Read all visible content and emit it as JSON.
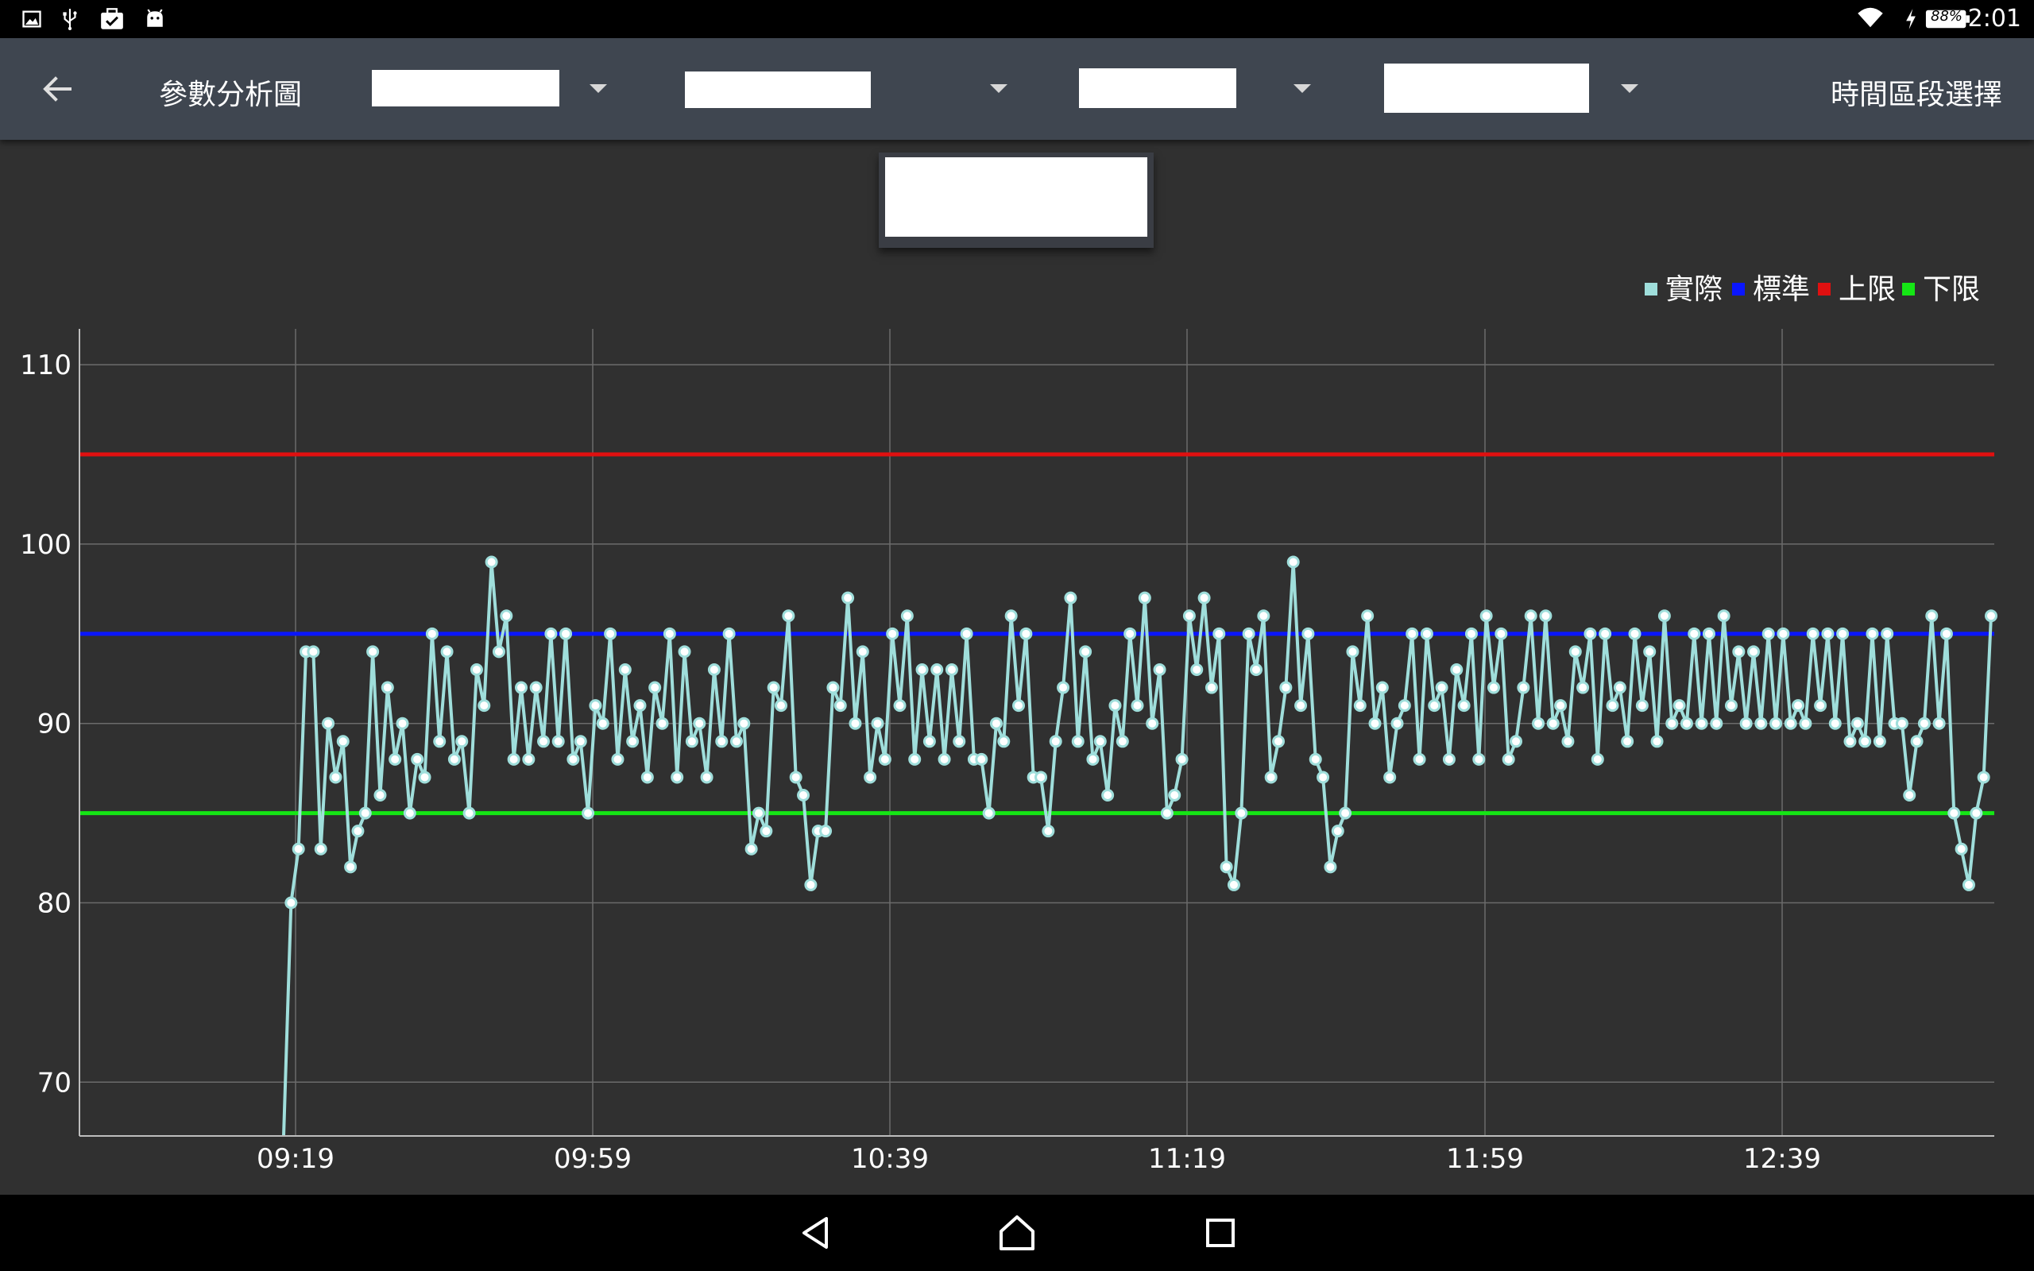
{
  "status_bar": {
    "time": "2:01",
    "battery": "88%",
    "left_icons": [
      "image-notification-icon",
      "usb-icon",
      "task-icon",
      "android-icon"
    ],
    "right_icons": [
      "wifi-icon",
      "charging-icon",
      "battery-icon"
    ]
  },
  "toolbar": {
    "title": "參數分析圖",
    "time_range_label": "時間區段選擇",
    "dropdowns": [
      {
        "value": ""
      },
      {
        "value": ""
      },
      {
        "value": ""
      },
      {
        "value": ""
      }
    ]
  },
  "center_card": {
    "value": ""
  },
  "colors": {
    "background": "#303030",
    "toolbar": "#3f4650",
    "actual": "#9fdedb",
    "standard": "#0a16ff",
    "upper_limit": "#e01010",
    "lower_limit": "#15e615",
    "grid": "#6b6b6b"
  },
  "chart_data": {
    "type": "line",
    "legend_position": "top-right",
    "grid": true,
    "ylim": [
      67,
      112
    ],
    "y_ticks": [
      70,
      80,
      90,
      100,
      110
    ],
    "x_tick_labels": [
      "09:19",
      "09:59",
      "10:39",
      "11:19",
      "11:59",
      "12:39"
    ],
    "x_range_minutes": [
      559,
      817
    ],
    "x_ticks_minutes": [
      559,
      599,
      639,
      679,
      719,
      759
    ],
    "actual_start_minute": 557,
    "series": [
      {
        "name": "實際",
        "color": "#9fdedb"
      },
      {
        "name": "標準",
        "color": "#0a16ff",
        "value": 95
      },
      {
        "name": "上限",
        "color": "#e01010",
        "value": 105
      },
      {
        "name": "下限",
        "color": "#15e615",
        "value": 85
      }
    ],
    "actual_values": [
      67,
      80,
      83,
      94,
      94,
      83,
      90,
      87,
      89,
      82,
      84,
      85,
      94,
      86,
      92,
      88,
      90,
      85,
      88,
      87,
      95,
      89,
      94,
      88,
      89,
      85,
      93,
      91,
      99,
      94,
      96,
      88,
      92,
      88,
      92,
      89,
      95,
      89,
      95,
      88,
      89,
      85,
      91,
      90,
      95,
      88,
      93,
      89,
      91,
      87,
      92,
      90,
      95,
      87,
      94,
      89,
      90,
      87,
      93,
      89,
      95,
      89,
      90,
      83,
      85,
      84,
      92,
      91,
      96,
      87,
      86,
      81,
      84,
      84,
      92,
      91,
      97,
      90,
      94,
      87,
      90,
      88,
      95,
      91,
      96,
      88,
      93,
      89,
      93,
      88,
      93,
      89,
      95,
      88,
      88,
      85,
      90,
      89,
      96,
      91,
      95,
      87,
      87,
      84,
      89,
      92,
      97,
      89,
      94,
      88,
      89,
      86,
      91,
      89,
      95,
      91,
      97,
      90,
      93,
      85,
      86,
      88,
      96,
      93,
      97,
      92,
      95,
      82,
      81,
      85,
      95,
      93,
      96,
      87,
      89,
      92,
      99,
      91,
      95,
      88,
      87,
      82,
      84,
      85,
      94,
      91,
      96,
      90,
      92,
      87,
      90,
      91,
      95,
      88,
      95,
      91,
      92,
      88,
      93,
      91,
      95,
      88,
      96,
      92,
      95,
      88,
      89,
      92,
      96,
      90,
      96,
      90,
      91,
      89,
      94,
      92,
      95,
      88,
      95,
      91,
      92,
      89,
      95,
      91,
      94,
      89,
      96,
      90,
      91,
      90,
      95,
      90,
      95,
      90,
      96,
      91,
      94,
      90,
      94,
      90,
      95,
      90,
      95,
      90,
      91,
      90,
      95,
      91,
      95,
      90,
      95,
      89,
      90,
      89,
      95,
      89,
      95,
      90,
      90,
      86,
      89,
      90,
      96,
      90,
      95,
      85,
      83,
      81,
      85,
      87,
      96
    ]
  },
  "nav_bar": {
    "buttons": [
      "back-icon",
      "home-icon",
      "recents-icon"
    ]
  }
}
